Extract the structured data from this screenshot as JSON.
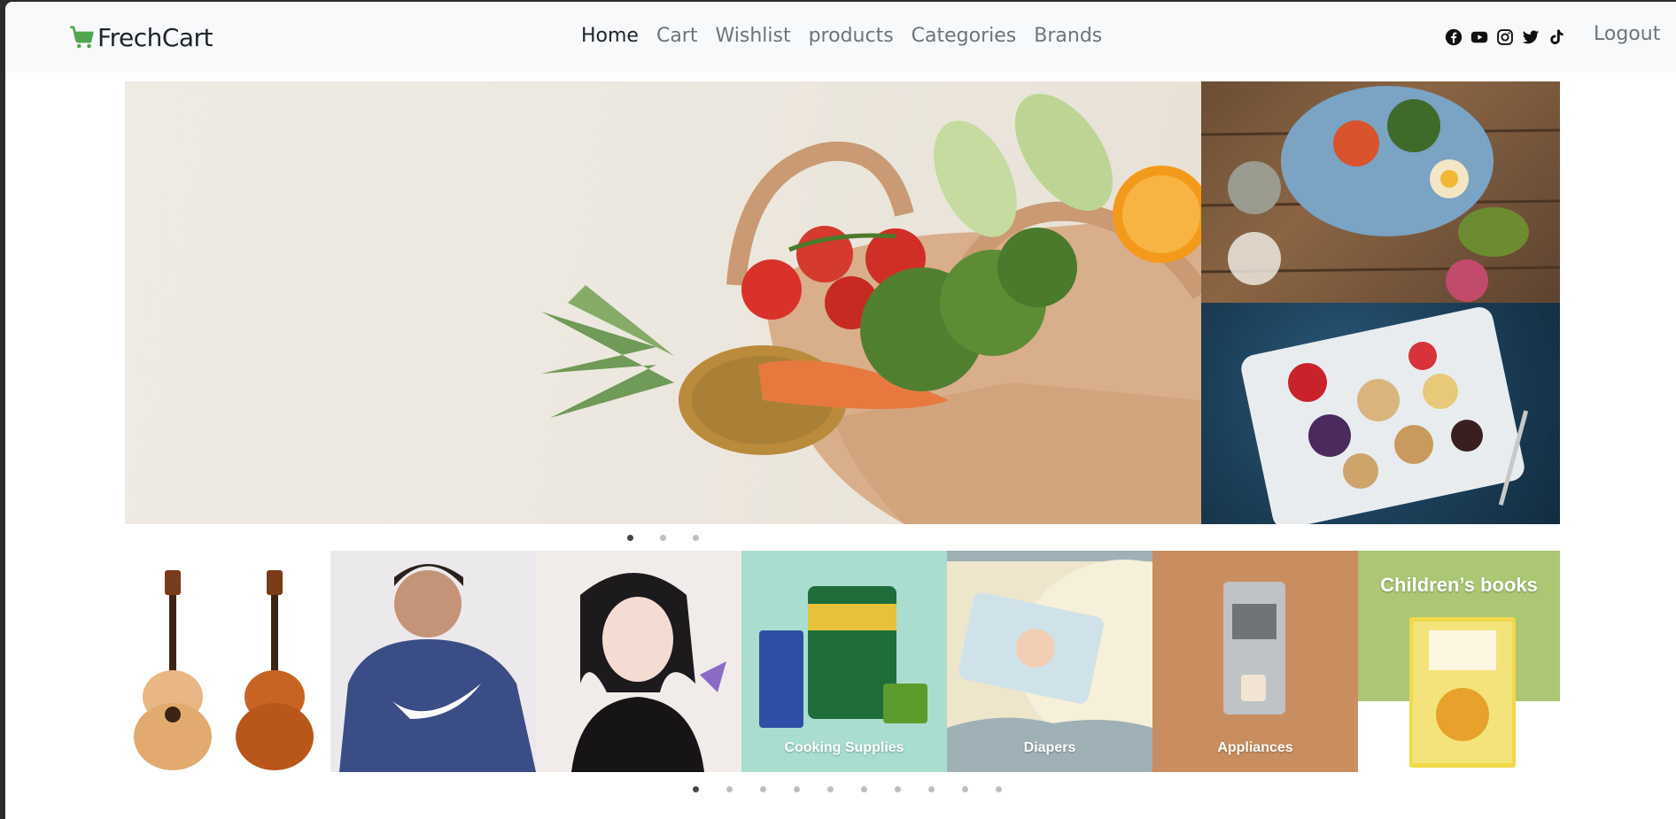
{
  "brand": {
    "name": "FrechCart",
    "accent": "#4fa74f"
  },
  "nav": {
    "links": [
      {
        "label": "Home",
        "active": true
      },
      {
        "label": "Cart",
        "active": false
      },
      {
        "label": "Wishlist",
        "active": false
      },
      {
        "label": "products",
        "active": false
      },
      {
        "label": "Categories",
        "active": false
      },
      {
        "label": "Brands",
        "active": false
      }
    ],
    "socials": [
      "facebook-icon",
      "youtube-icon",
      "instagram-icon",
      "twitter-icon",
      "tiktok-icon"
    ],
    "logout_label": "Logout"
  },
  "hero": {
    "slides": 3,
    "active_slide": 0
  },
  "categories": {
    "tiles": [
      {
        "label": ""
      },
      {
        "label": ""
      },
      {
        "label": ""
      },
      {
        "label": "Cooking Supplies"
      },
      {
        "label": "Diapers"
      },
      {
        "label": "Appliances"
      },
      {
        "label": "Children’s books"
      }
    ],
    "pages": 10,
    "active_page": 0
  }
}
